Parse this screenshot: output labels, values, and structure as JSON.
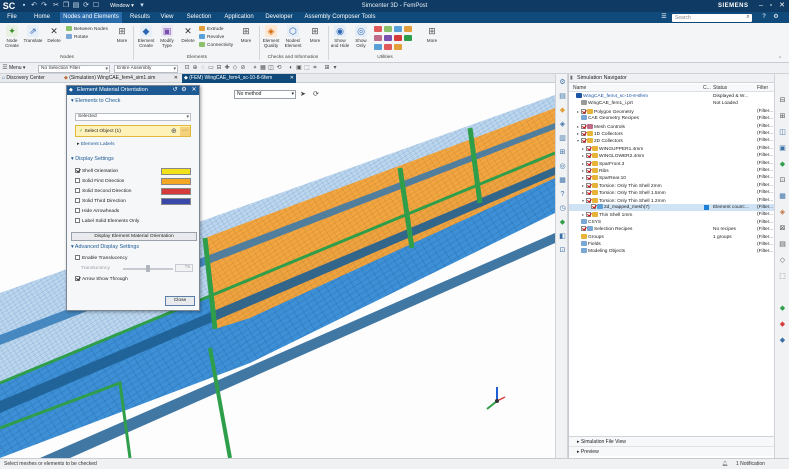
{
  "titlebar": {
    "logo": "SC",
    "window_menu": "Window ▾",
    "title": "Simcenter 3D - FemPost",
    "brand": "SIEMENS"
  },
  "menu": {
    "items": [
      "File",
      "Home",
      "Nodes and Elements",
      "Results",
      "View",
      "Selection",
      "Application",
      "Developer",
      "Assembly Composer Tools"
    ],
    "active_index": 2,
    "search_placeholder": "Search"
  },
  "ribbon": {
    "nodes": {
      "node_create": "Node Create",
      "translate": "Translate",
      "delete": "Delete",
      "between_nodes": "Between Nodes",
      "rotate": "Rotate",
      "more": "More",
      "group": "Nodes"
    },
    "elements": {
      "element_create": "Element Create",
      "modify_type": "Modify Type",
      "delete": "Delete",
      "extrude": "Extrude",
      "revolve": "Revolve",
      "connectivity": "Connectivity",
      "more": "More",
      "group": "Elements"
    },
    "checks": {
      "element_quality": "Element Quality",
      "nodes_element": "Nodes/ Element",
      "more": "More",
      "group": "Checks and Information"
    },
    "utilities": {
      "show_hide": "Show and Hide",
      "show_only": "Show Only",
      "more": "More",
      "group": "Utilities"
    }
  },
  "toolbar": {
    "menu_label": "Menu ▾",
    "selection_filter": "No Selection Filter",
    "assembly_scope": "Entire Assembly"
  },
  "tabs": [
    {
      "label": "Discovery Center"
    },
    {
      "label": "(Simulation) WingCAE_fem4_sim1.sim"
    },
    {
      "label": "(FEM) WingCAE_fem4_sc-10-8-6fem"
    }
  ],
  "active_tab": 2,
  "viewport": {
    "method_dropdown": "No method"
  },
  "dialog": {
    "title": "Element Material Orientation",
    "elements_to_check": {
      "header": "Elements to Check",
      "selection_dropdown": "Selected",
      "select_object": "Select Object (1)",
      "element_labels": "Element Labels"
    },
    "display_settings": {
      "header": "Display Settings",
      "items": [
        {
          "label": "Shell Orientation",
          "checked": true,
          "color": "#f2e01a"
        },
        {
          "label": "Solid First Direction",
          "checked": false,
          "color": "#f5a623"
        },
        {
          "label": "Solid Second Direction",
          "checked": false,
          "color": "#d63b3b"
        },
        {
          "label": "Solid Third Direction",
          "checked": false,
          "color": "#3949ab"
        },
        {
          "label": "Hide Arrowheads",
          "checked": false
        },
        {
          "label": "Label Solid Elements Only",
          "checked": false
        }
      ],
      "display_button": "Display Element Material Orientation"
    },
    "advanced": {
      "header": "Advanced Display Settings",
      "enable_translucency": "Enable Translucency",
      "translucency_label": "Translucency",
      "translucency_value": "75",
      "arrow_show_through": "Arrow Show Through"
    },
    "close_button": "Close"
  },
  "navigator": {
    "title": "Simulation Navigator",
    "columns": [
      "Name",
      "C...",
      "Status",
      "Filter"
    ],
    "rows": [
      {
        "indent": 0,
        "name": "WingCAE_fem4_sc-10-8-6fem",
        "status": "Displayed & W...",
        "filter": "",
        "check": false,
        "icon": "#1b55a3",
        "blue": true,
        "twisty": ""
      },
      {
        "indent": 1,
        "name": "WingCAE_fem1_i.prt",
        "status": "Not Loaded",
        "filter": "",
        "check": false,
        "icon": "#999999",
        "twisty": ""
      },
      {
        "indent": 1,
        "name": "Polygon Geometry",
        "status": "",
        "filter": "(Filter...",
        "check": true,
        "icon": "#e7b43a",
        "twisty": "▸"
      },
      {
        "indent": 1,
        "name": "CAE Geometry Recipes",
        "status": "",
        "filter": "(Filter...",
        "check": false,
        "icon": "#7aa6d6",
        "twisty": ""
      },
      {
        "indent": 1,
        "name": "Mesh Controls",
        "status": "",
        "filter": "(Filter...",
        "check": true,
        "icon": "#c06b8a",
        "twisty": "▸"
      },
      {
        "indent": 1,
        "name": "1D Collectors",
        "status": "",
        "filter": "(Filter...",
        "check": true,
        "icon": "#e7b43a",
        "twisty": "▸"
      },
      {
        "indent": 1,
        "name": "2D Collectors",
        "status": "",
        "filter": "(Filter...",
        "check": true,
        "icon": "#e7b43a",
        "twisty": "▾"
      },
      {
        "indent": 2,
        "name": "WINGUPPER1.4mm",
        "status": "",
        "filter": "(Filter...",
        "check": true,
        "icon": "#e7b43a",
        "twisty": "▸"
      },
      {
        "indent": 2,
        "name": "WINGLOWER2.4mm",
        "status": "",
        "filter": "(Filter...",
        "check": true,
        "icon": "#e7b43a",
        "twisty": "▸"
      },
      {
        "indent": 2,
        "name": "SparFront.3",
        "status": "",
        "filter": "(Filter...",
        "check": true,
        "icon": "#e7b43a",
        "twisty": "▸"
      },
      {
        "indent": 2,
        "name": "Ribs",
        "status": "",
        "filter": "(Filter...",
        "check": true,
        "icon": "#e7b43a",
        "twisty": "▸"
      },
      {
        "indent": 2,
        "name": "SparRear.10",
        "status": "",
        "filter": "(Filter...",
        "check": true,
        "icon": "#e7b43a",
        "twisty": "▸"
      },
      {
        "indent": 2,
        "name": "Torsion: Only Thin Shell 2mm",
        "status": "",
        "filter": "(Filter...",
        "check": true,
        "icon": "#e7b43a",
        "twisty": "▸"
      },
      {
        "indent": 2,
        "name": "Torsion: Only Thin Shell 1.5mm",
        "status": "",
        "filter": "(Filter...",
        "check": true,
        "icon": "#e7b43a",
        "twisty": "▸"
      },
      {
        "indent": 2,
        "name": "Torsion: Only Thin Shell 1.2mm",
        "status": "",
        "filter": "(Filter...",
        "check": true,
        "icon": "#e7b43a",
        "twisty": "▾"
      },
      {
        "indent": 3,
        "name": "2d_mapped_mesh(7)",
        "status": "Element count:...",
        "filter": "(Filter...",
        "check": true,
        "icon": "#5aa0d8",
        "selected": true,
        "swatch": "#1e7fd6",
        "twisty": ""
      },
      {
        "indent": 2,
        "name": "Thin Shell 1mm",
        "status": "",
        "filter": "(Filter...",
        "check": true,
        "icon": "#e7b43a",
        "twisty": "▸"
      },
      {
        "indent": 1,
        "name": "CSYS",
        "status": "",
        "filter": "(Filter...",
        "check": false,
        "icon": "#7aa6d6",
        "twisty": ""
      },
      {
        "indent": 1,
        "name": "Selection Recipes",
        "status": "No recipes",
        "filter": "(Filter...",
        "check": true,
        "icon": "#7aa6d6",
        "twisty": ""
      },
      {
        "indent": 1,
        "name": "Groups",
        "status": "1 groups",
        "filter": "(Filter...",
        "check": false,
        "icon": "#e7b43a",
        "twisty": ""
      },
      {
        "indent": 1,
        "name": "Fields",
        "status": "",
        "filter": "(Filter...",
        "check": false,
        "icon": "#7aa6d6",
        "twisty": ""
      },
      {
        "indent": 1,
        "name": "Modeling Objects",
        "status": "",
        "filter": "(Filter...",
        "check": false,
        "icon": "#7aa6d6",
        "twisty": ""
      }
    ],
    "footer": [
      "Simulation File View",
      "Preview"
    ]
  },
  "status": {
    "message": "Select meshes or elements to be checked",
    "notification": "1 Notification"
  },
  "colors": {
    "titlebar": "#0f3a63",
    "menubar": "#0f4a7a",
    "accent": "#1d5a93",
    "mesh_blue": "#3d8fd6",
    "mesh_orange": "#f4a43a",
    "mesh_green": "#2f9e4a"
  }
}
